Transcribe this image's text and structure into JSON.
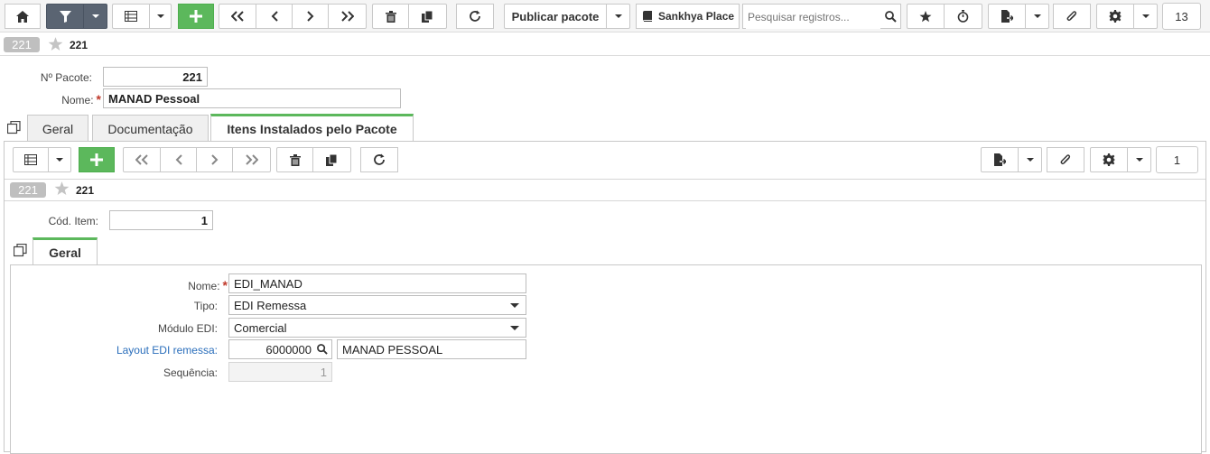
{
  "toolbar": {
    "publish_label": "Publicar pacote",
    "place_label": "Sankhya Place",
    "search_placeholder": "Pesquisar registros...",
    "record_count": "13"
  },
  "header": {
    "badge": "221",
    "title": "221"
  },
  "form": {
    "pacote_label": "Nº Pacote:",
    "pacote_value": "221",
    "nome_label": "Nome:",
    "nome_value": "MANAD Pessoal"
  },
  "tabs": [
    {
      "label": "Geral"
    },
    {
      "label": "Documentação"
    },
    {
      "label": "Itens Instalados pelo Pacote"
    }
  ],
  "subtoolbar": {
    "record_count": "1"
  },
  "subheader": {
    "badge": "221",
    "title": "221"
  },
  "item": {
    "cod_label": "Cód. Item:",
    "cod_value": "1"
  },
  "subtabs": [
    {
      "label": "Geral"
    }
  ],
  "detail": {
    "nome_label": "Nome:",
    "nome_value": "EDI_MANAD",
    "tipo_label": "Tipo:",
    "tipo_value": "EDI Remessa",
    "modulo_label": "Módulo EDI:",
    "modulo_value": "Comercial",
    "layout_label": "Layout EDI remessa:",
    "layout_code": "6000000",
    "layout_desc": "MANAD PESSOAL",
    "seq_label": "Sequência:",
    "seq_value": "1"
  }
}
